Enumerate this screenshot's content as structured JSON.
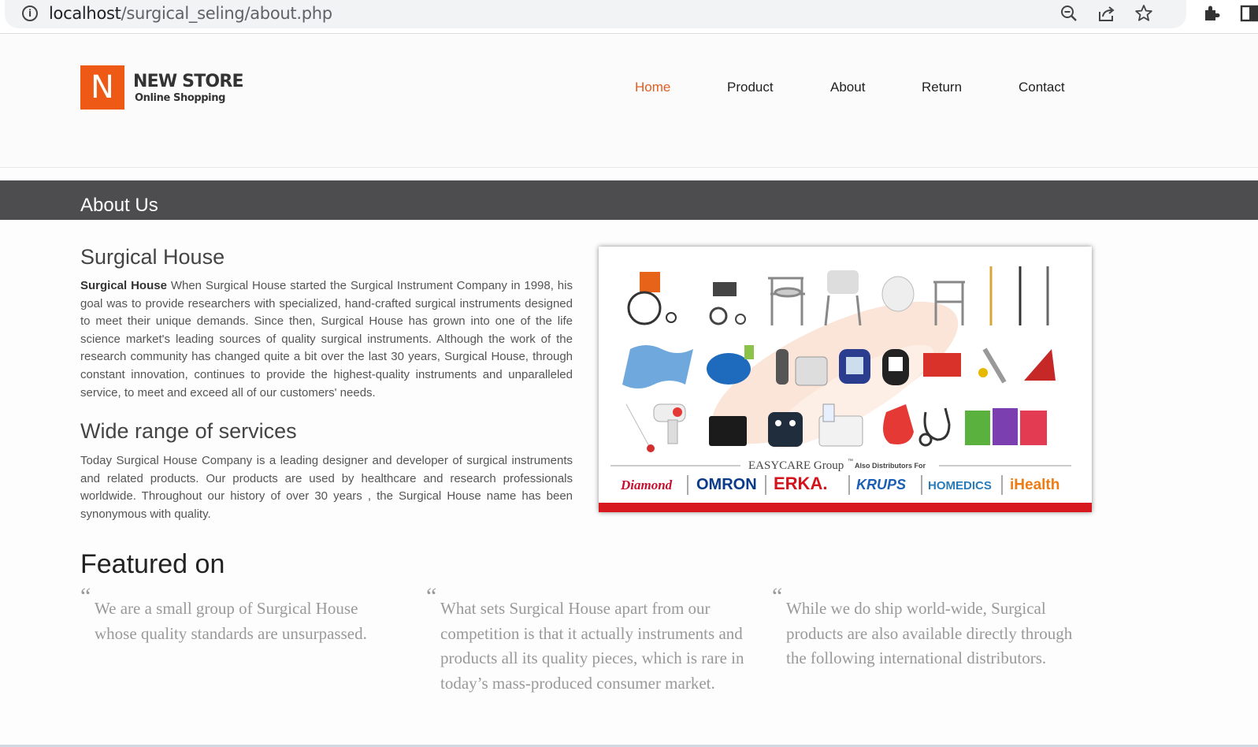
{
  "browser": {
    "url_host": "localhost",
    "url_path": "/surgical_seling/about.php"
  },
  "brand": {
    "logo_letter": "N",
    "name": "NEW STORE",
    "tagline": "Online Shopping",
    "accent": "#ee5a16"
  },
  "nav": {
    "items": [
      {
        "label": "Home",
        "active": true
      },
      {
        "label": "Product",
        "active": false
      },
      {
        "label": "About",
        "active": false
      },
      {
        "label": "Return",
        "active": false
      },
      {
        "label": "Contact",
        "active": false
      }
    ]
  },
  "about": {
    "heading": "About Us",
    "section1_title": "Surgical House",
    "section1_bold": "Surgical House",
    "section1_text": " When Surgical House started the Surgical Instrument Company in 1998, his goal was to provide researchers with specialized, hand-crafted surgical instruments designed to meet their unique demands. Since then, Surgical House has grown into one of the life science market's leading sources of quality surgical instruments. Although the work of the research community has changed quite a bit over the last 30 years, Surgical House, through constant innovation, continues to provide the highest-quality instruments and unparalleled service, to meet and exceed all of our customers' needs.",
    "section2_title": "Wide range of services",
    "section2_text": "Today Surgical House Company is a leading designer and developer of surgical instruments and related products. Our products are used by healthcare and research professionals worldwide. Throughout our history of over 30 years , the Surgical House name has been synonymous with quality."
  },
  "banner": {
    "group_label": "EASYCARE Group",
    "group_tm": "™",
    "distributors_label": "Also Distributors For",
    "brands": [
      "Diamond",
      "OMRON",
      "ERKA.",
      "KRUPS",
      "HOMEDICS",
      "iHealth"
    ]
  },
  "featured": {
    "title": "Featured on",
    "quote_mark": "“",
    "quotes": [
      "We are a small group of Surgical House whose quality standards are unsurpassed.",
      "What sets Surgical House apart from our competition is that it actually instruments and products all its quality pieces, which is rare in today’s mass-produced consumer market.",
      "While we do ship world-wide, Surgical products are also available directly through the following international distributors."
    ]
  }
}
